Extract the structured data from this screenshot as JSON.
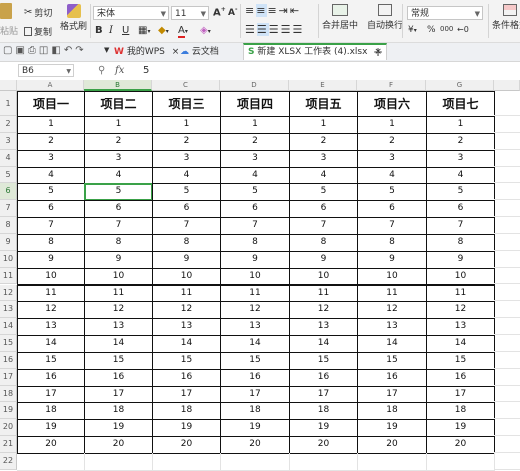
{
  "ribbon": {
    "cut_label": "剪切",
    "copy_label": "复制",
    "format_painter_label": "格式刷",
    "paste_label": "粘贴",
    "font_name": "宋体",
    "font_size": "11",
    "bold": "B",
    "italic": "I",
    "underline": "U",
    "merge_center_label": "合并居中",
    "wrap_text_label": "自动换行",
    "number_format": "常规",
    "conditional_format_label": "条件格式",
    "percent": "%",
    "comma": "000"
  },
  "tabs": {
    "my_wps": "我的WPS",
    "cloud_docs": "云文档",
    "workbook": "新建 XLSX 工作表 (4).xlsx"
  },
  "formula_bar": {
    "name_box": "B6",
    "fx": "fx",
    "value": "5"
  },
  "sheet": {
    "columns": [
      "A",
      "B",
      "C",
      "D",
      "E",
      "F",
      "G"
    ],
    "headers": [
      "项目一",
      "项目二",
      "项目三",
      "项目四",
      "项目五",
      "项目六",
      "项目七"
    ],
    "row_numbers": [
      "1",
      "2",
      "3",
      "4",
      "5",
      "6",
      "7",
      "8",
      "9",
      "10",
      "11",
      "12",
      "13",
      "14",
      "15",
      "16",
      "17",
      "18",
      "19",
      "20",
      "21",
      "22"
    ],
    "values": [
      "1",
      "2",
      "3",
      "4",
      "5",
      "6",
      "7",
      "8",
      "9",
      "10",
      "11",
      "12",
      "13",
      "14",
      "15",
      "16",
      "17",
      "18",
      "19",
      "20"
    ],
    "active_cell": "B6",
    "accent": "#3aa148"
  }
}
